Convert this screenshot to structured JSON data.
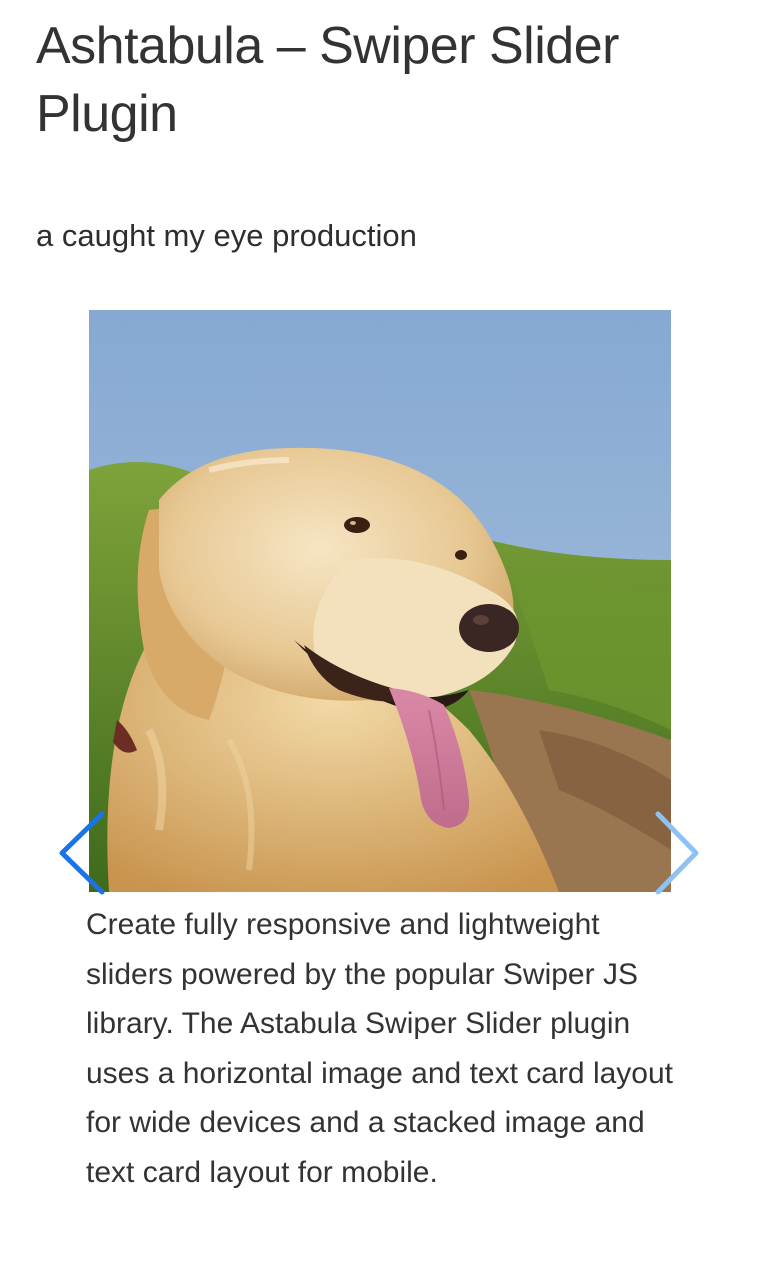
{
  "page": {
    "title": "Ashtabula – Swiper Slider Plugin",
    "tagline": "a caught my eye production"
  },
  "slider": {
    "slide": {
      "image_subject": "golden retriever with tongue out in a sunny field",
      "text": "Create fully responsive and lightweight sliders powered by the popular Swiper JS library. The Astabula Swiper Slider plugin uses a horizontal image and text card layout for wide devices and a stacked image and text card layout for mobile."
    },
    "prev_icon": "chevron-left-icon",
    "next_icon": "chevron-right-icon"
  },
  "colors": {
    "arrow_prev": "#1a73e8",
    "arrow_next": "#8ec2f5",
    "sky": "#8fb0d6",
    "grass": "#5f8a2a",
    "dog_fur": "#e9cf9f"
  }
}
